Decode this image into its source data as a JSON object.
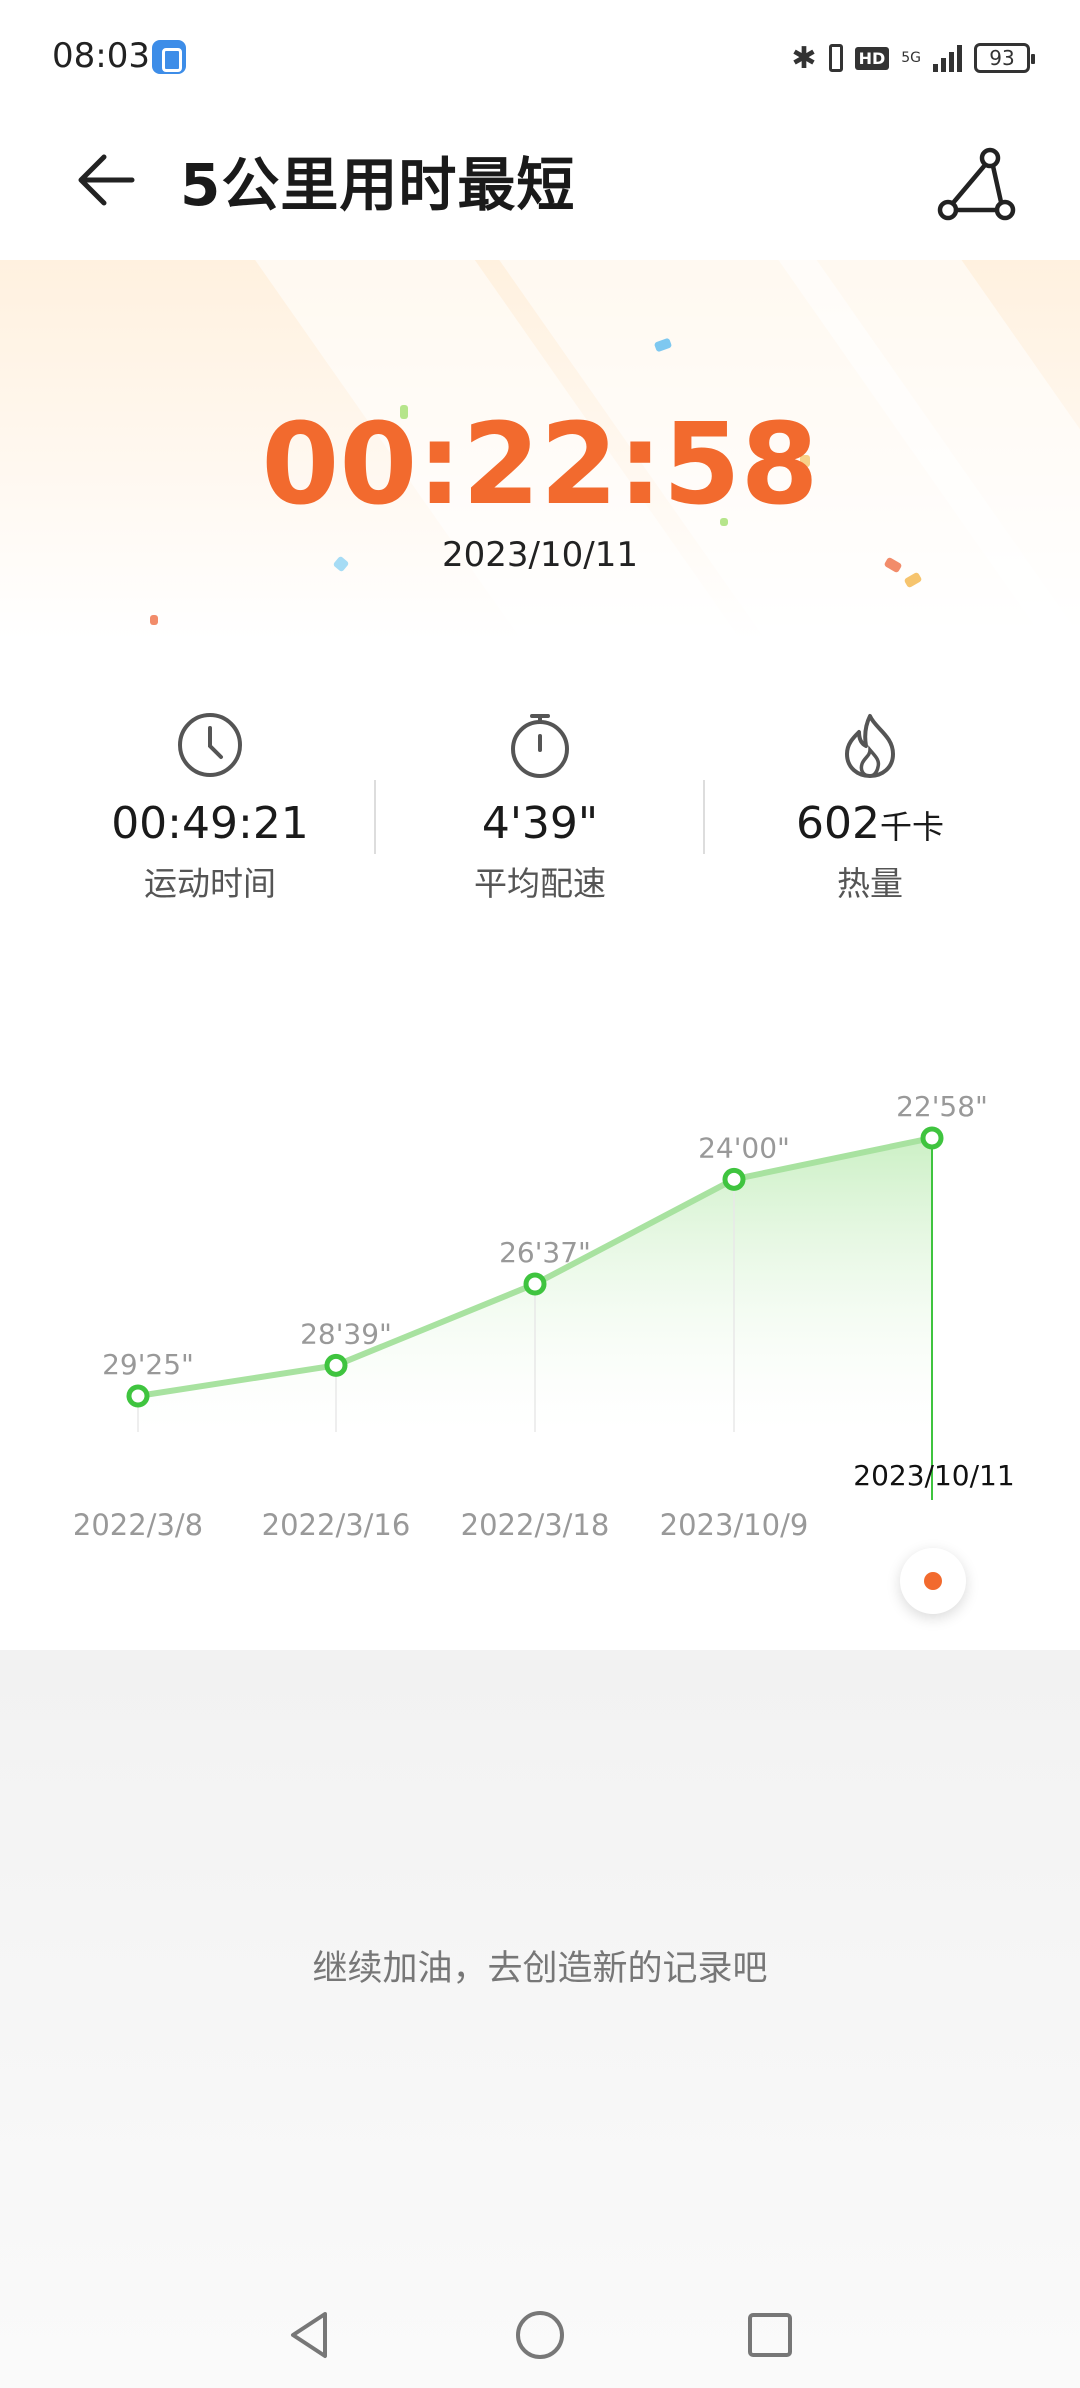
{
  "status_bar": {
    "time": "08:03",
    "network": "5G",
    "hd": "HD",
    "battery": "93"
  },
  "header": {
    "title": "5公里用时最短"
  },
  "hero": {
    "best_time": "00:22:58",
    "date": "2023/10/11"
  },
  "stats": [
    {
      "icon": "clock-icon",
      "value": "00:49:21",
      "unit": "",
      "label": "运动时间"
    },
    {
      "icon": "stopwatch-icon",
      "value": "4'39\"",
      "unit": "",
      "label": "平均配速"
    },
    {
      "icon": "flame-icon",
      "value": "602",
      "unit": "千卡",
      "label": "热量"
    }
  ],
  "chart_data": {
    "type": "area",
    "categories": [
      "2022/3/8",
      "2022/3/16",
      "2022/3/18",
      "2023/10/9",
      "2023/10/11"
    ],
    "value_labels": [
      "29'25\"",
      "28'39\"",
      "26'37\"",
      "24'00\"",
      "22'58\""
    ],
    "values_seconds": [
      1765,
      1719,
      1597,
      1440,
      1378
    ],
    "y_inverted": true,
    "selected_index": 4,
    "colors": {
      "line": "#a8e2a0",
      "point": "#3fc43f",
      "fill_top": "#c9efc2",
      "selected_line": "#3fc43f"
    }
  },
  "encourage_text": "继续加油，去创造新的记录吧",
  "accent_color": "#f26a2e"
}
